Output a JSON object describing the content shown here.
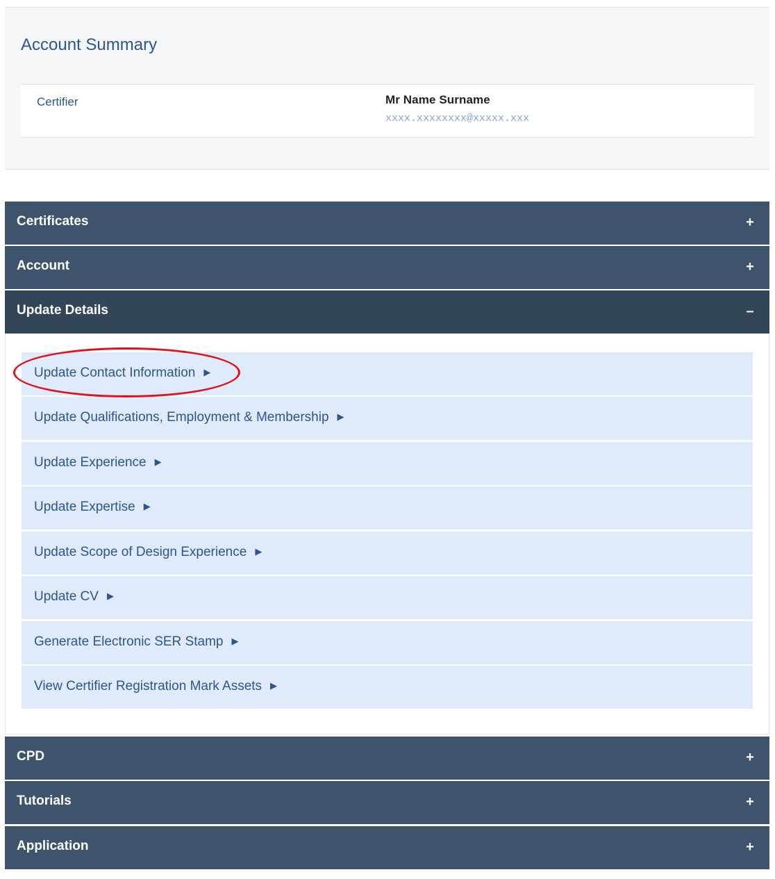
{
  "account_summary": {
    "title": "Account Summary",
    "role_label": "Certifier",
    "name": "Mr Name Surname",
    "email": "xxxx.xxxxxxxx@xxxxx.xxx"
  },
  "sections": {
    "certificates": {
      "label": "Certificates",
      "toggle": "+"
    },
    "account": {
      "label": "Account",
      "toggle": "+"
    },
    "update_details": {
      "label": "Update Details",
      "toggle": "–"
    },
    "cpd": {
      "label": "CPD",
      "toggle": "+"
    },
    "tutorials": {
      "label": "Tutorials",
      "toggle": "+"
    },
    "application": {
      "label": "Application",
      "toggle": "+"
    }
  },
  "update_details_items": [
    {
      "label": "Update Contact Information",
      "arrow": "▶"
    },
    {
      "label": "Update Qualifications, Employment & Membership",
      "arrow": "▶"
    },
    {
      "label": "Update Experience",
      "arrow": "▶"
    },
    {
      "label": "Update Expertise",
      "arrow": "▶"
    },
    {
      "label": "Update Scope of Design Experience",
      "arrow": "▶"
    },
    {
      "label": "Update CV",
      "arrow": "▶"
    },
    {
      "label": "Generate Electronic SER Stamp",
      "arrow": "▶"
    },
    {
      "label": "View Certifier Registration Mark Assets",
      "arrow": "▶"
    }
  ],
  "colors": {
    "bar_bg": "#3e546d",
    "bar_open_bg": "#334559",
    "item_bg": "#dfeafa",
    "link_text": "#2d5590",
    "highlight": "#e3101a"
  }
}
